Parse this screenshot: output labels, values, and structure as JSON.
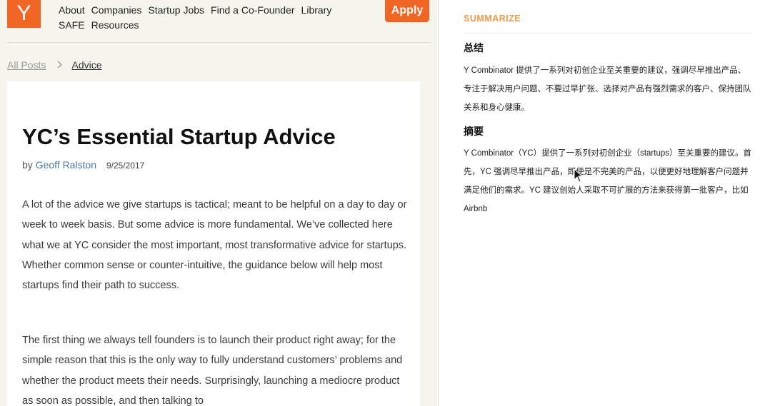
{
  "site": {
    "logo": "Y",
    "nav_row1": [
      "About",
      "Companies",
      "Startup Jobs",
      "Find a Co-Founder",
      "Library"
    ],
    "nav_row2": [
      "SAFE",
      "Resources"
    ],
    "apply_label": "Apply"
  },
  "breadcrumb": {
    "all_posts": "All Posts",
    "current": "Advice"
  },
  "article": {
    "title": "YC’s Essential Startup Advice",
    "by": "by",
    "author": "Geoff Ralston",
    "date": "9/25/2017",
    "paragraphs": [
      "A lot of the advice we give startups is tactical; meant to be helpful on a day to day or week to week basis. But some advice is more fundamental. We’ve collected here what we at YC consider the most important, most transformative advice for startups. Whether common sense or counter-intuitive, the guidance below will help most startups find their path to success.",
      "The first thing we always tell founders is to launch their product right away; for the simple reason that this is the only way to fully understand customers’ problems and whether the product meets their needs. Surprisingly, launching a mediocre product as soon as possible, and then talking to"
    ]
  },
  "panel": {
    "label": "SUMMARIZE",
    "sections": [
      {
        "heading": "总结",
        "text": "Y Combinator 提供了一系列对初创企业至关重要的建议，强调尽早推出产品、专注于解决用户问题、不要过早扩张、选择对产品有强烈需求的客户、保持团队关系和身心健康。"
      },
      {
        "heading": "摘要",
        "text": "Y Combinator（YC）提供了一系列对初创企业（startups）至关重要的建议。首先，YC 强调尽早推出产品，即使是不完美的产品，以便更好地理解客户问题并满足他们的需求。YC 建议创始人采取不可扩展的方法来获得第一批客户，比如 Airbnb"
      }
    ]
  },
  "colors": {
    "brand_orange": "#f26625",
    "panel_label": "#f2994a",
    "author_link": "#4a7aa8"
  }
}
